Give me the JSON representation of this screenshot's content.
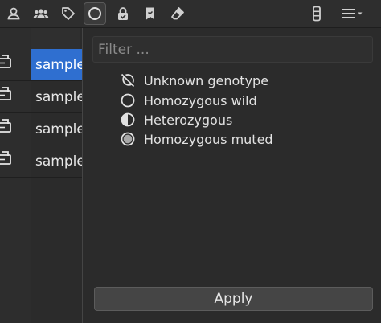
{
  "toolbar": {
    "icons": [
      "user-icon",
      "group-icon",
      "tag-icon",
      "circle-icon",
      "lock-icon",
      "bookmark-icon",
      "eraser-icon",
      "columns-icon",
      "menu-icon"
    ]
  },
  "samples": [
    {
      "label": "sample",
      "selected": true
    },
    {
      "label": "sample",
      "selected": false
    },
    {
      "label": "sample",
      "selected": false
    },
    {
      "label": "sample",
      "selected": false
    }
  ],
  "popup": {
    "filter_placeholder": "Filter ...",
    "options": [
      {
        "label": "Unknown genotype",
        "icon": "unknown-genotype-icon"
      },
      {
        "label": "Homozygous wild",
        "icon": "homozygous-wild-icon"
      },
      {
        "label": "Heterozygous",
        "icon": "heterozygous-icon"
      },
      {
        "label": "Homozygous muted",
        "icon": "homozygous-muted-icon"
      }
    ],
    "apply_label": "Apply"
  }
}
